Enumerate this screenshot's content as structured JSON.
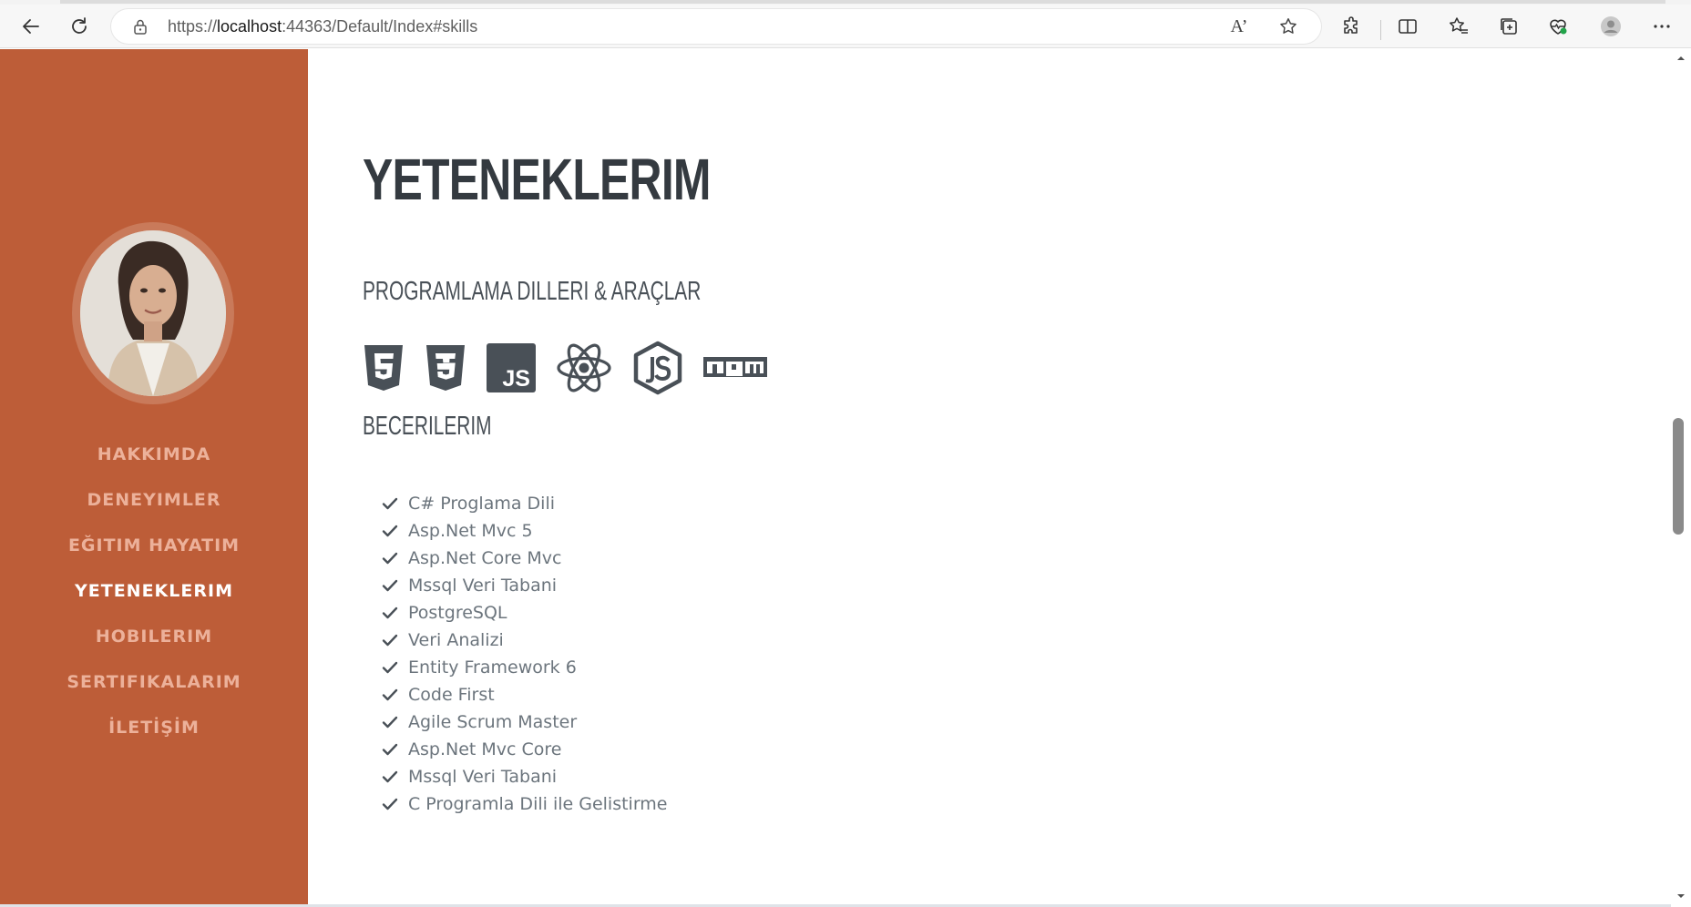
{
  "browser": {
    "url_host": "localhost",
    "url_prefix": "https://",
    "url_rest": ":44363/Default/Index#skills",
    "read_aloud_label": "A’"
  },
  "sidebar": {
    "nav": [
      {
        "label": "HAKKIMDA",
        "active": false
      },
      {
        "label": "DENEYIMLER",
        "active": false
      },
      {
        "label": "EĞITIM HAYATIM",
        "active": false
      },
      {
        "label": "YETENEKLERIM",
        "active": true
      },
      {
        "label": "HOBILERIM",
        "active": false
      },
      {
        "label": "SERTIFIKALARIM",
        "active": false
      },
      {
        "label": "İLETİŞİM",
        "active": false
      }
    ]
  },
  "main": {
    "title": "YETENEKLERIM",
    "tools_heading": "PROGRAMLAMA DILLERI & ARAÇLAR",
    "tool_icons": [
      "html5-icon",
      "css3-icon",
      "javascript-icon",
      "react-icon",
      "nodejs-icon",
      "npm-icon"
    ],
    "npm_label": "npm",
    "js_label": "JS",
    "skills_heading": "BECERILERIM",
    "skills": [
      "C# Proglama Dili",
      "Asp.Net Mvc 5",
      "Asp.Net Core Mvc",
      "Mssql Veri Tabani",
      "PostgreSQL",
      "Veri Analizi",
      "Entity Framework 6",
      "Code First",
      "Agile Scrum Master",
      "Asp.Net Mvc Core",
      "Mssql Veri Tabani",
      "C Programla Dili ile Gelistirme"
    ]
  },
  "colors": {
    "sidebar": "#bd5d38",
    "nav_text": "#ecb19a",
    "nav_active": "#ffffff",
    "heading": "#343a40",
    "text": "#6c757d"
  }
}
